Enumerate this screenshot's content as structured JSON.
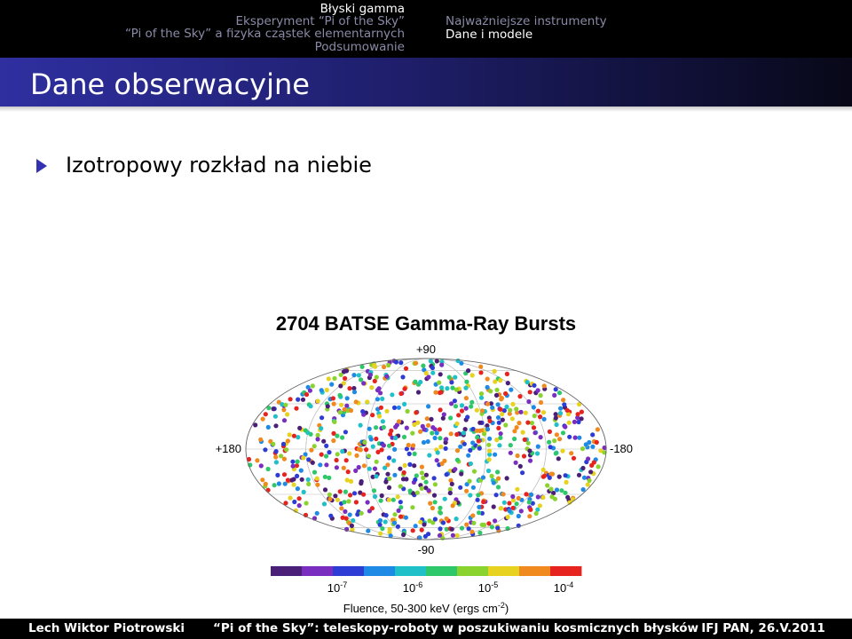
{
  "nav": {
    "sections": [
      "Błyski gamma",
      "Eksperyment “Pi of the Sky”",
      "“Pi of the Sky” a fizyka cząstek elementarnych",
      "Podsumowanie"
    ],
    "active_section": 0,
    "subsections": [
      "Najważniejsze instrumenty",
      "Dane i modele"
    ],
    "active_subsection": 1
  },
  "frame": {
    "title": "Dane obserwacyjne",
    "bullet": "Izotropowy rozkład na niebie"
  },
  "figure": {
    "title": "2704 BATSE Gamma-Ray Bursts",
    "label_top": "+90",
    "label_bottom": "-90",
    "label_left": "+180",
    "label_right": "-180",
    "colorbar_ticks": [
      "10-7",
      "10-6",
      "10-5",
      "10-4"
    ],
    "colorbar_label": "Fluence, 50-300 keV (ergs cm-2)",
    "colors": [
      "#4b1f78",
      "#7a2ec0",
      "#2e3cd6",
      "#1f8ae6",
      "#1fc0c8",
      "#2ec86a",
      "#8ad22e",
      "#e6d21f",
      "#f08a1f",
      "#e6231f"
    ]
  },
  "chart_data": {
    "type": "scatter",
    "title": "2704 BATSE Gamma-Ray Bursts",
    "projection": "aitoff",
    "axis_labels": {
      "longitude_left": "+180",
      "longitude_right": "-180",
      "latitude_top": "+90",
      "latitude_bottom": "-90"
    },
    "xlim": [
      180,
      -180
    ],
    "ylim": [
      -90,
      90
    ],
    "points_count": 2704,
    "distribution": "isotropic",
    "color_scale": {
      "label": "Fluence, 50-300 keV (ergs cm-2)",
      "ticks": [
        "10-7",
        "10-6",
        "10-5",
        "10-4"
      ],
      "min": 1e-07,
      "max": 0.0001
    }
  },
  "footer": {
    "author": "Lech Wiktor Piotrowski",
    "talk": "“Pi of the Sky”: teleskopy-roboty w poszukiwaniu kosmicznych błysków",
    "venue": "IFJ PAN, 26.V.2011"
  }
}
